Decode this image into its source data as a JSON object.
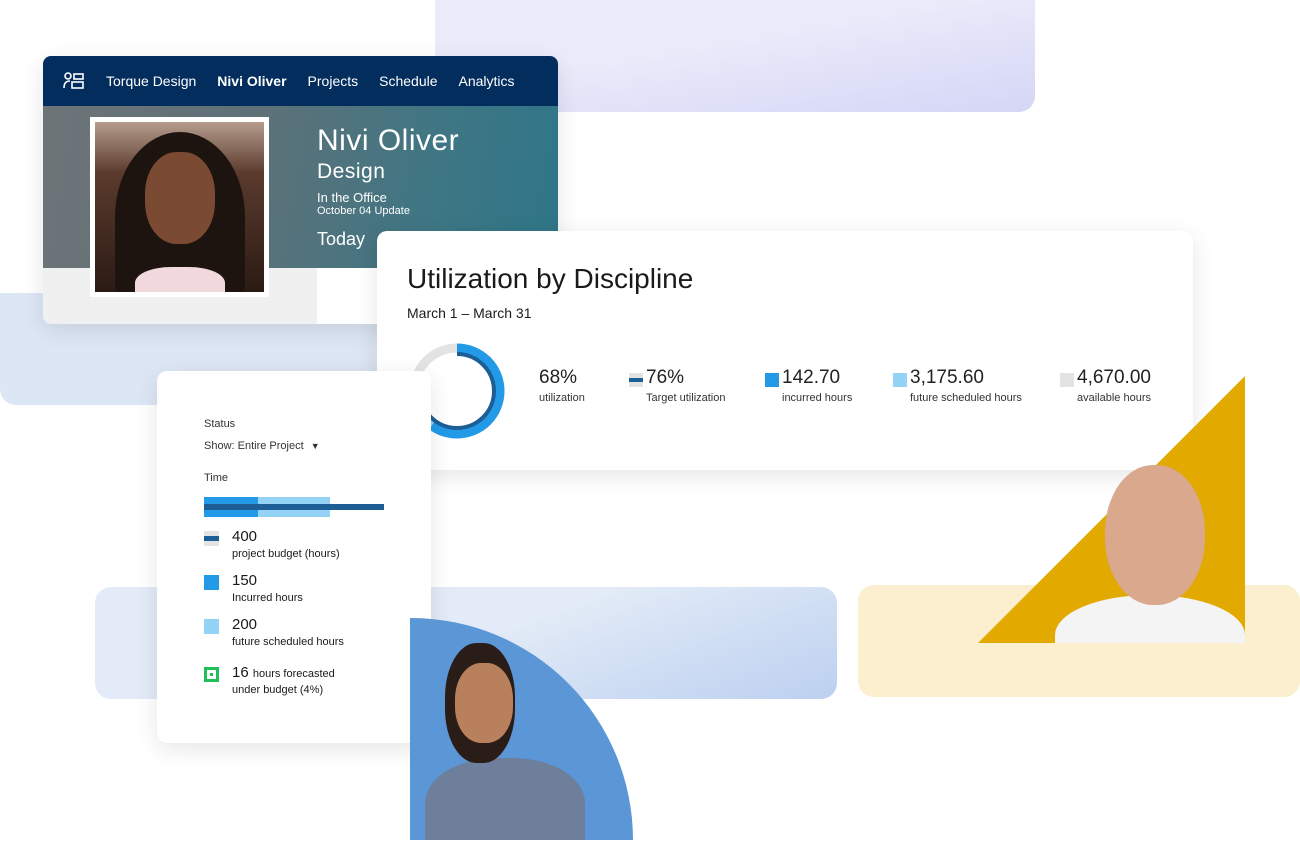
{
  "nav": {
    "icon": "people-directory-icon",
    "items": [
      {
        "label": "Torque Design",
        "active": false
      },
      {
        "label": "Nivi Oliver",
        "active": true
      },
      {
        "label": "Projects",
        "active": false
      },
      {
        "label": "Schedule",
        "active": false
      },
      {
        "label": "Analytics",
        "active": false
      }
    ]
  },
  "profile": {
    "name": "Nivi Oliver",
    "department": "Design",
    "location": "In the Office",
    "update": "October 04 Update",
    "today": "Today"
  },
  "utilization": {
    "title": "Utilization by Discipline",
    "date_range": "March 1 – March 31",
    "stats": [
      {
        "value": "68%",
        "label": "utilization"
      },
      {
        "value": "76%",
        "label": "Target utilization",
        "color": "#1d5e96"
      },
      {
        "value": "142.70",
        "label": "incurred hours",
        "color": "#229ae8"
      },
      {
        "value": "3,175.60",
        "label": "future scheduled hours",
        "color": "#94d3f5"
      },
      {
        "value": "4,670.00",
        "label": "available hours",
        "color": "#e3e3e3"
      }
    ],
    "donut": {
      "utilization_pct": 68,
      "incurred_pct": 60,
      "future_pct": 8,
      "target_pct": 76
    }
  },
  "status": {
    "title": "Status",
    "filter": "Show: Entire Project",
    "time_label": "Time",
    "bar": {
      "budget": 400,
      "incurred": 150,
      "future": 200
    },
    "legend": [
      {
        "value": "400",
        "label": "project budget (hours)",
        "color": "#1d5e96"
      },
      {
        "value": "150",
        "label": "Incurred hours",
        "color": "#229ae8"
      },
      {
        "value": "200",
        "label": "future scheduled hours",
        "color": "#94d3f5"
      },
      {
        "value": "16",
        "label": "hours forecasted",
        "label2": "under budget (4%)",
        "color": "#1fbf5a"
      }
    ]
  }
}
